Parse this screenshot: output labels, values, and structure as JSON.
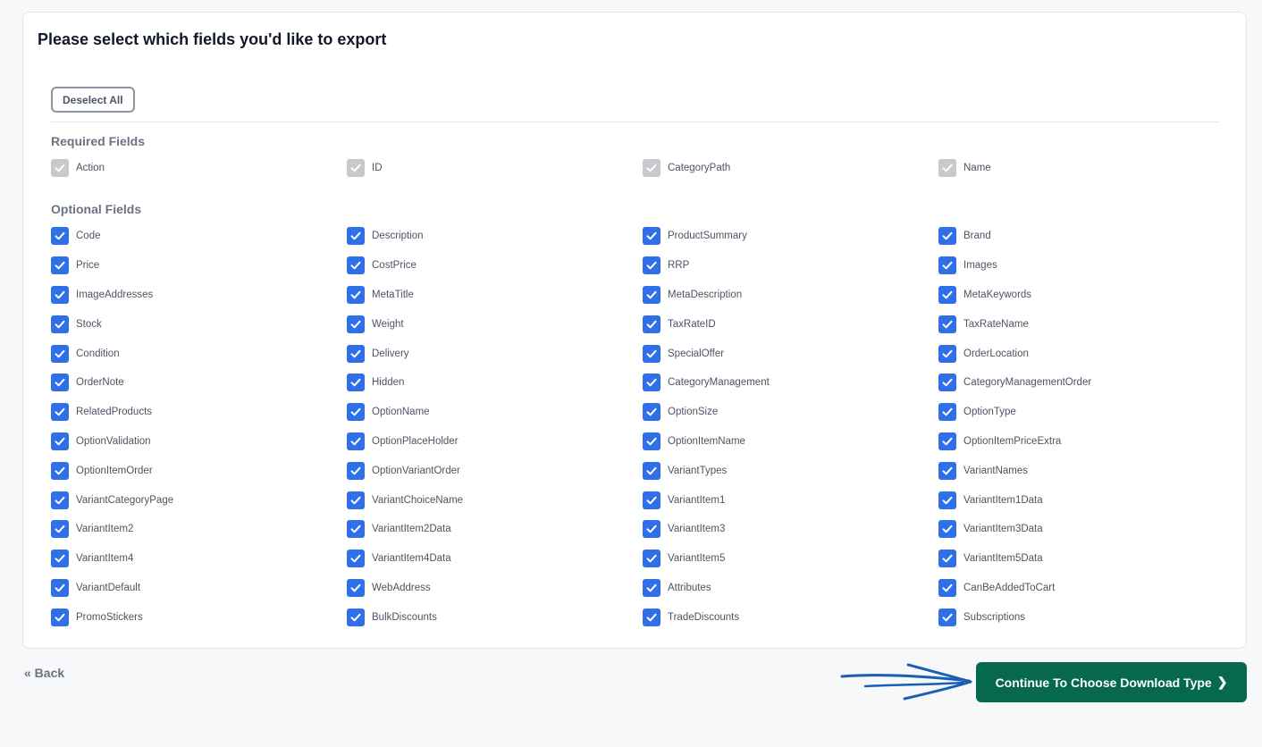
{
  "header": {
    "title": "Please select which fields you'd like to export"
  },
  "toolbar": {
    "deselect_all_label": "Deselect All"
  },
  "required": {
    "title": "Required Fields",
    "fields": [
      "Action",
      "ID",
      "CategoryPath",
      "Name"
    ]
  },
  "optional": {
    "title": "Optional Fields",
    "fields": [
      "Code",
      "Description",
      "ProductSummary",
      "Brand",
      "Price",
      "CostPrice",
      "RRP",
      "Images",
      "ImageAddresses",
      "MetaTitle",
      "MetaDescription",
      "MetaKeywords",
      "Stock",
      "Weight",
      "TaxRateID",
      "TaxRateName",
      "Condition",
      "Delivery",
      "SpecialOffer",
      "OrderLocation",
      "OrderNote",
      "Hidden",
      "CategoryManagement",
      "CategoryManagementOrder",
      "RelatedProducts",
      "OptionName",
      "OptionSize",
      "OptionType",
      "OptionValidation",
      "OptionPlaceHolder",
      "OptionItemName",
      "OptionItemPriceExtra",
      "OptionItemOrder",
      "OptionVariantOrder",
      "VariantTypes",
      "VariantNames",
      "VariantCategoryPage",
      "VariantChoiceName",
      "VariantItem1",
      "VariantItem1Data",
      "VariantItem2",
      "VariantItem2Data",
      "VariantItem3",
      "VariantItem3Data",
      "VariantItem4",
      "VariantItem4Data",
      "VariantItem5",
      "VariantItem5Data",
      "VariantDefault",
      "WebAddress",
      "Attributes",
      "CanBeAddedToCart",
      "PromoStickers",
      "BulkDiscounts",
      "TradeDiscounts",
      "Subscriptions"
    ]
  },
  "footer": {
    "back_label": "« Back",
    "continue_label": "Continue To Choose Download Type",
    "continue_icon": "chevron-right-icon"
  },
  "colors": {
    "checkbox_checked": "#2f6fe8",
    "checkbox_disabled": "#c7c9cc",
    "primary_button": "#06694e",
    "annotation_arrow": "#1a5fb4"
  }
}
